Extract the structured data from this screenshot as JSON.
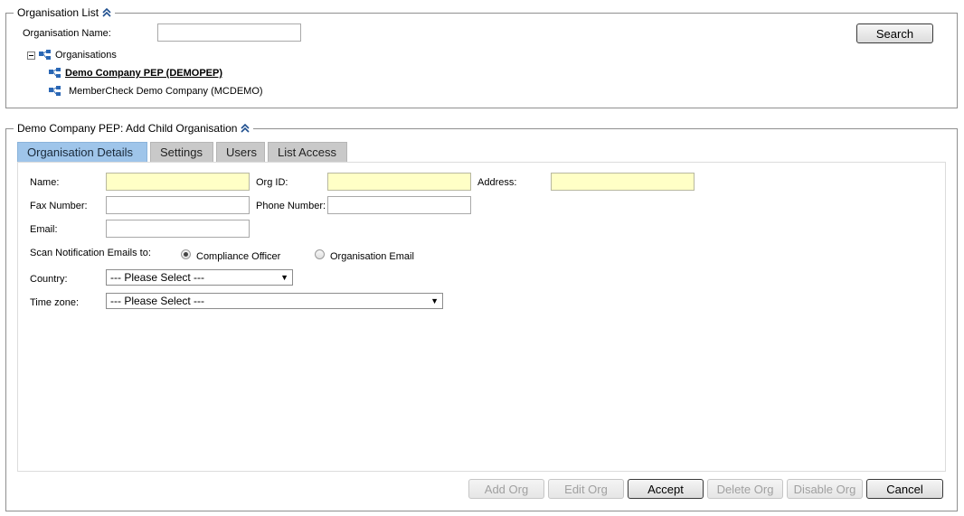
{
  "org_list": {
    "legend": "Organisation List",
    "name_label": "Organisation Name:",
    "name_value": "",
    "search_label": "Search",
    "tree": {
      "root_label": "Organisations",
      "children": [
        {
          "label": "Demo Company PEP (DEMOPEP)"
        },
        {
          "label": "MemberCheck Demo Company (MCDEMO)"
        }
      ]
    }
  },
  "add_child": {
    "legend": "Demo Company PEP: Add Child Organisation",
    "tabs": [
      {
        "label": "Organisation Details"
      },
      {
        "label": "Settings"
      },
      {
        "label": "Users"
      },
      {
        "label": "List Access"
      }
    ],
    "form": {
      "name_label": "Name:",
      "org_id_label": "Org ID:",
      "address_label": "Address:",
      "fax_label": "Fax Number:",
      "phone_label": "Phone Number:",
      "email_label": "Email:",
      "scan_label": "Scan Notification Emails to:",
      "radio_compliance": "Compliance Officer",
      "radio_org_email": "Organisation Email",
      "country_label": "Country:",
      "country_value": "--- Please Select ---",
      "timezone_label": "Time zone:",
      "timezone_value": "--- Please Select ---"
    },
    "buttons": {
      "add_org": "Add Org",
      "edit_org": "Edit Org",
      "accept": "Accept",
      "delete_org": "Delete Org",
      "disable_org": "Disable Org",
      "cancel": "Cancel"
    }
  }
}
